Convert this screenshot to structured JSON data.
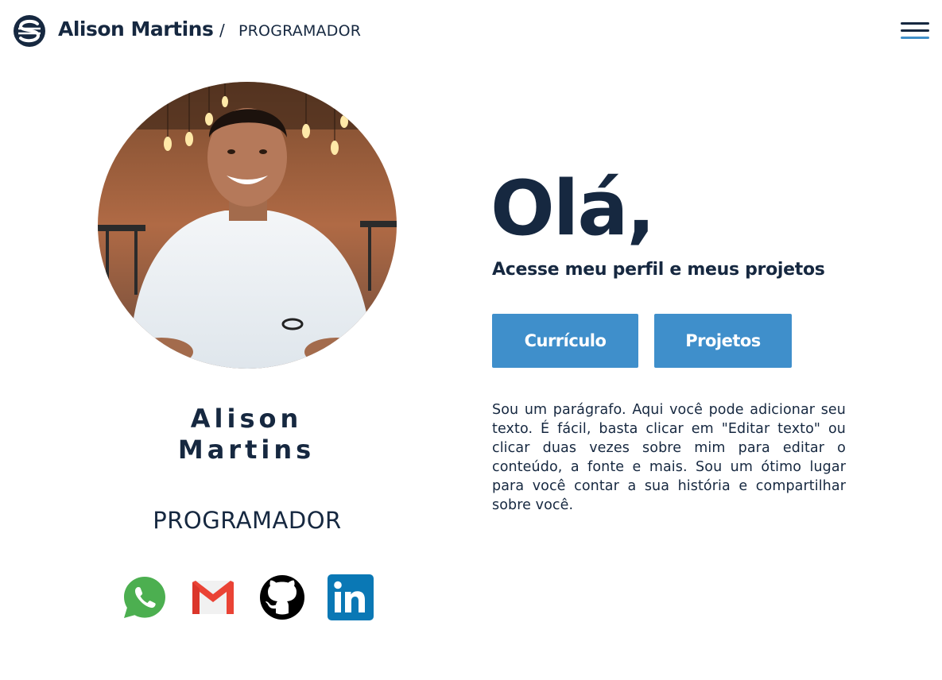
{
  "header": {
    "site_name": "Alison Martins",
    "separator": "/",
    "role": "PROGRAMADOR"
  },
  "profile": {
    "name_line1": "Alison",
    "name_line2": "Martins",
    "role": "PROGRAMADOR"
  },
  "hero": {
    "greeting": "Olá,",
    "subtitle": "Acesse meu perfil e meus projetos",
    "buttons": {
      "curriculo": "Currículo",
      "projetos": "Projetos"
    },
    "paragraph": "Sou um parágrafo. Aqui você pode adicionar seu texto. É fácil, basta clicar em \"Editar texto\" ou clicar duas vezes sobre mim para editar o conteúdo, a fonte e mais. Sou um ótimo lugar para você contar a sua história e compartilhar sobre você."
  },
  "socials": [
    {
      "icon": "whatsapp-icon",
      "color": "#4caf50"
    },
    {
      "icon": "gmail-icon",
      "color": "#ea4335"
    },
    {
      "icon": "github-icon",
      "color": "#000000"
    },
    {
      "icon": "linkedin-icon",
      "color": "#0a78b5"
    }
  ],
  "colors": {
    "primary_text": "#162840",
    "accent": "#3f8fcb"
  }
}
